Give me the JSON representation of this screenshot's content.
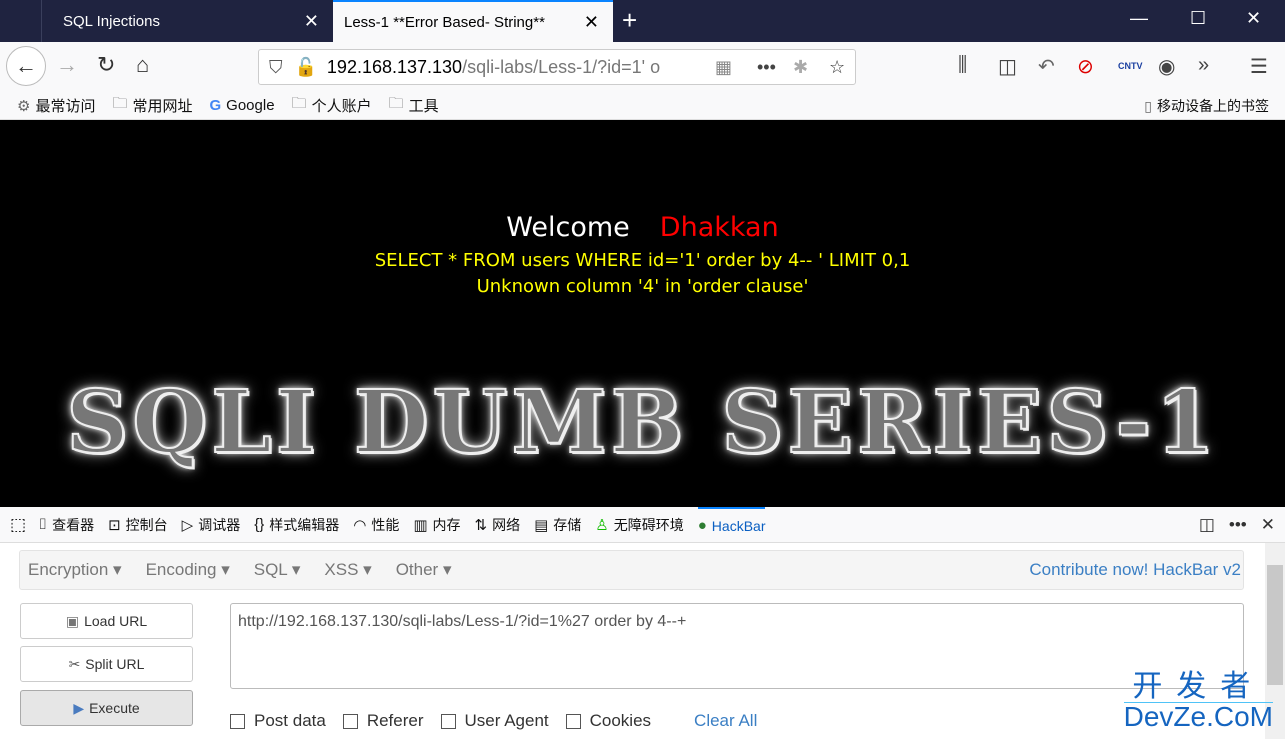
{
  "browser": {
    "tabs": [
      {
        "title": "SQL Injections",
        "active": false
      },
      {
        "title": "Less-1 **Error Based- String**",
        "active": true
      }
    ],
    "close_glyph": "✕",
    "new_tab_glyph": "+",
    "window_controls": {
      "minimize": "—",
      "maximize": "☐",
      "close": "✕"
    },
    "url": {
      "host": "192.168.137.130",
      "rest": "/sqli-labs/Less-1/?id=1' o"
    },
    "bookmarks": [
      {
        "label": "最常访问",
        "icon": "gear-icon"
      },
      {
        "label": "常用网址",
        "icon": "folder-icon"
      },
      {
        "label": "Google",
        "icon": "google-icon"
      },
      {
        "label": "个人账户",
        "icon": "folder-icon"
      },
      {
        "label": "工具",
        "icon": "folder-icon"
      }
    ],
    "mobile_bookmarks": "移动设备上的书签"
  },
  "page": {
    "welcome": "Welcome",
    "name": "Dhakkan",
    "query": "SELECT * FROM users WHERE id='1' order by 4-- ' LIMIT 0,1",
    "error": "Unknown column '4' in 'order clause'",
    "banner": "SQLI DUMB SERIES-1"
  },
  "devtools": {
    "tabs": [
      {
        "label": "查看器",
        "icon": "inspector-icon"
      },
      {
        "label": "控制台",
        "icon": "console-icon"
      },
      {
        "label": "调试器",
        "icon": "debugger-icon"
      },
      {
        "label": "样式编辑器",
        "icon": "style-editor-icon"
      },
      {
        "label": "性能",
        "icon": "performance-icon"
      },
      {
        "label": "内存",
        "icon": "memory-icon"
      },
      {
        "label": "网络",
        "icon": "network-icon"
      },
      {
        "label": "存储",
        "icon": "storage-icon"
      },
      {
        "label": "无障碍环境",
        "icon": "accessibility-icon"
      },
      {
        "label": "HackBar",
        "icon": "hackbar-icon",
        "active": true
      }
    ]
  },
  "hackbar": {
    "menus": [
      "Encryption",
      "Encoding",
      "SQL",
      "XSS",
      "Other"
    ],
    "contribute": "Contribute now! HackBar v2",
    "buttons": {
      "load": "Load URL",
      "split": "Split URL",
      "execute": "Execute"
    },
    "url_value": "http://192.168.137.130/sqli-labs/Less-1/?id=1%27 order by 4--+",
    "options": [
      {
        "label": "Post data",
        "checked": false
      },
      {
        "label": "Referer",
        "checked": false
      },
      {
        "label": "User Agent",
        "checked": false
      },
      {
        "label": "Cookies",
        "checked": false
      }
    ],
    "clear_all": "Clear All"
  },
  "watermark": {
    "cn": "开发者",
    "en": "DevZe.CoM"
  },
  "colors": {
    "tabbar": "#1f2340",
    "accent": "#0a84ff",
    "welcome_name": "#ff0000",
    "sql_text": "#ffff00",
    "hackbar_link": "#3b7fc4"
  }
}
